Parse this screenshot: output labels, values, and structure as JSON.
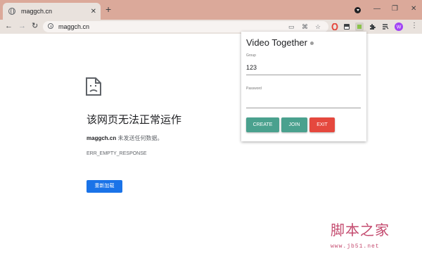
{
  "browser": {
    "tab_title": "maggch.cn",
    "tab_close": "✕",
    "new_tab": "+",
    "window_controls": {
      "minimize": "—",
      "maximize": "❐",
      "close": "✕"
    },
    "address": "maggch.cn",
    "profile_initial": "W",
    "colors": {
      "tabstrip": "#dba99a",
      "toolbar": "#e9e2dd"
    }
  },
  "error_page": {
    "title": "该网页无法正常运作",
    "domain": "maggch.cn",
    "description": " 未发送任何数据。",
    "error_code": "ERR_EMPTY_RESPONSE",
    "reload_label": "重新加载"
  },
  "popup": {
    "title": "Video Together",
    "group_label": "Group",
    "group_value": "123",
    "password_label": "Password",
    "password_value": "",
    "buttons": {
      "create": "CREATE",
      "join": "JOIN",
      "exit": "EXIT"
    },
    "colors": {
      "create": "#4aa18e",
      "join": "#4aa18e",
      "exit": "#e5483e"
    }
  },
  "watermark": {
    "text": "脚本之家",
    "url": "www.jb51.net"
  }
}
